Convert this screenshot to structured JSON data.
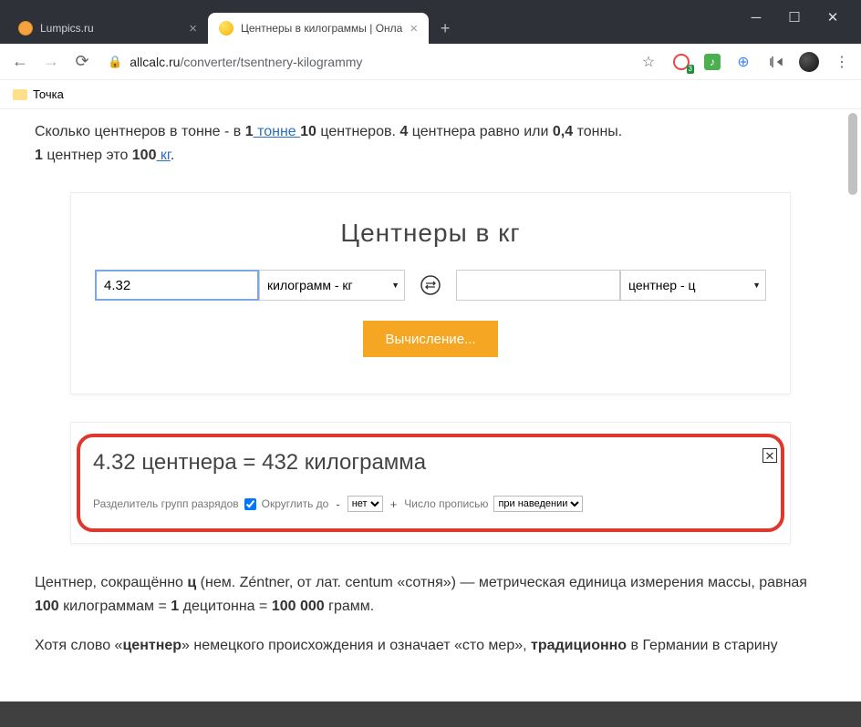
{
  "window": {
    "tabs": [
      {
        "title": "Lumpics.ru",
        "active": false
      },
      {
        "title": "Центнеры в килограммы | Онла",
        "active": true
      }
    ]
  },
  "address": {
    "domain": "allcalc.ru",
    "path": "/converter/tsentnery-kilogrammy"
  },
  "bookmarks": {
    "item1": "Точка"
  },
  "intro": {
    "part1": "Сколько центнеров в тонне - в ",
    "b1": "1",
    "link1": " тонне ",
    "b2": "10",
    "part2": " центнеров. ",
    "b3": "4",
    "part3": " центнера равно или ",
    "b4": "0,4",
    "part4": " тонны.",
    "line2a": "1",
    "line2b": " центнер это ",
    "line2c": "100",
    "link2": " кг",
    "line2d": "."
  },
  "calculator": {
    "title": "Центнеры в кг",
    "input_value": "4.32",
    "unit_from": "килограмм - кг",
    "input2_value": "",
    "unit_to": "центнер - ц",
    "button": "Вычисление..."
  },
  "result": {
    "text": "4.32 центнера = 432 килограмма",
    "opt_separator_label": "Разделитель групп разрядов",
    "opt_round_label": "Округлить до",
    "opt_round_value": "нет",
    "opt_words_label": "Число прописью",
    "opt_words_value": "при наведении"
  },
  "description": {
    "p1a": "Центнер, сокращённо ",
    "p1b": "ц",
    "p1c": " (нем. Zéntner, от лат. centum «сотня») — метрическая единица измерения массы, равная ",
    "p1d": "100",
    "p1e": " килограммам = ",
    "p1f": "1",
    "p1g": " децитонна = ",
    "p1h": "100 000",
    "p1i": " грамм.",
    "p2a": "Хотя слово «",
    "p2b": "центнер",
    "p2c": "» немецкого происхождения и означает «сто мер», ",
    "p2d": "традиционно",
    "p2e": " в Германии в старину"
  }
}
